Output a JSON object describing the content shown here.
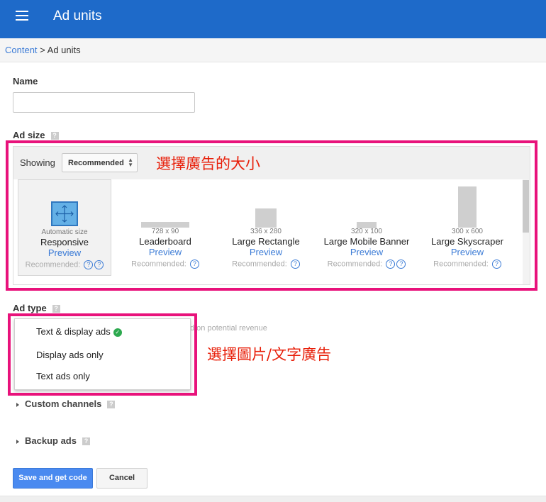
{
  "header": {
    "title": "Ad units",
    "menu_icon": "hamburger-menu-icon",
    "background": "#1e6ac9"
  },
  "breadcrumb": {
    "link": "Content",
    "separator": " > ",
    "current": "Ad units"
  },
  "name_field": {
    "label": "Name",
    "value": ""
  },
  "ad_size": {
    "label": "Ad size",
    "help": "?",
    "showing_label": "Showing",
    "showing_value": "Recommended",
    "sizes": [
      {
        "dim": "Automatic size",
        "name": "Responsive",
        "preview": "Preview",
        "recommended": "Recommended:",
        "help_count": 2,
        "selected": true
      },
      {
        "dim": "728 x 90",
        "name": "Leaderboard",
        "preview": "Preview",
        "recommended": "Recommended:",
        "help_count": 1
      },
      {
        "dim": "336 x 280",
        "name": "Large Rectangle",
        "preview": "Preview",
        "recommended": "Recommended:",
        "help_count": 1
      },
      {
        "dim": "320 x 100",
        "name": "Large Mobile Banner",
        "preview": "Preview",
        "recommended": "Recommended:",
        "help_count": 2
      },
      {
        "dim": "300 x 600",
        "name": "Large Skyscraper",
        "preview": "Preview",
        "recommended": "Recommended:",
        "help_count": 1
      }
    ]
  },
  "annotations": {
    "size": "選擇廣告的大小",
    "type": "選擇圖片/文字廣告",
    "color": "#e8127b"
  },
  "ad_type": {
    "label": "Ad type",
    "help": "?",
    "hidden_text": "d on potential revenue",
    "options": [
      {
        "label": "Text & display ads",
        "selected": true
      },
      {
        "label": "Display ads only"
      },
      {
        "label": "Text ads only"
      }
    ]
  },
  "custom_channels": {
    "label": "Custom channels",
    "help": "?"
  },
  "backup_ads": {
    "label": "Backup ads",
    "help": "?"
  },
  "actions": {
    "save": "Save and get code",
    "cancel": "Cancel",
    "save_color": "#4a8af0"
  }
}
